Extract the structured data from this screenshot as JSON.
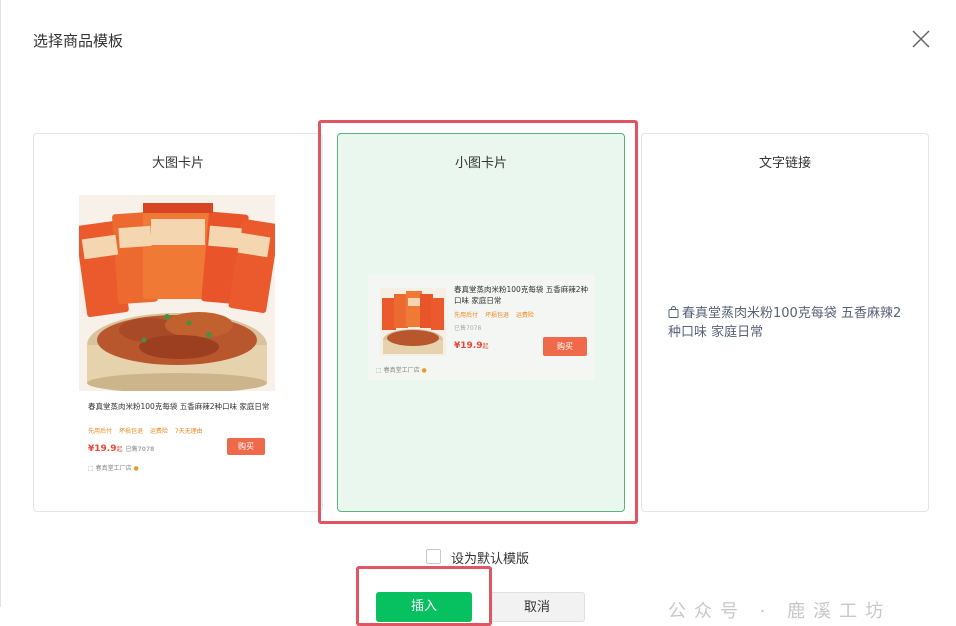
{
  "dialog": {
    "title": "选择商品模板",
    "close_icon": "close-icon"
  },
  "cards": {
    "large": {
      "title": "大图卡片"
    },
    "small": {
      "title": "小图卡片",
      "selected": true
    },
    "text": {
      "title": "文字链接"
    }
  },
  "product": {
    "brand": "春真堂",
    "image_words": [
      "蒸肉米粉",
      "五香味",
      "麻辣"
    ],
    "name_large": "春真堂蒸肉米粉100克每袋 五香麻辣2种口味 家庭日常",
    "name_small": "春真堂蒸肉米粉100克每袋 五香麻辣2种口味 家庭日常",
    "name_text_link": "春真堂蒸肉米粉100克每袋 五香麻辣2种口味 家庭日常",
    "tags_large": [
      "先用后付",
      "坏损包退",
      "运费险",
      "7天无理由"
    ],
    "tags_small": [
      "先用后付",
      "坏损包退",
      "运费险"
    ],
    "price": "¥19.9",
    "price_suffix": "起",
    "sold": "已售7078",
    "buy_label": "购买",
    "shop": "春真堂工厂店"
  },
  "footer": {
    "default_checkbox_label": "设为默认模版",
    "insert_label": "插入",
    "cancel_label": "取消",
    "watermark": "公众号 · 鹿溪工坊"
  },
  "colors": {
    "accent_green": "#07c160",
    "selected_card_bg": "#e9f7ee",
    "highlight_red": "#e05561",
    "price_red": "#e8473a",
    "buy_button": "#ee6a4a",
    "tag_orange": "#f08a24"
  }
}
